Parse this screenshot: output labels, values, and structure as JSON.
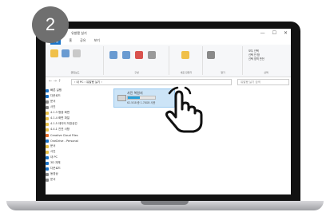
{
  "step": {
    "number": "2"
  },
  "window": {
    "title": "유발됐 실기",
    "minimize": "—",
    "maximize": "☐",
    "close": "✕"
  },
  "menu": [
    "파일",
    "홈",
    "공유",
    "보기"
  ],
  "ribbon": {
    "groups": [
      {
        "label": "클립보드",
        "buttons": [
          "즐겨찾기에 고정",
          "복사",
          "붙여넣기"
        ]
      },
      {
        "label": "구성",
        "buttons": [
          "이동",
          "복사",
          "삭제",
          "이름 바꾸기"
        ]
      },
      {
        "label": "새로 만들기",
        "buttons": [
          "새 폴더"
        ]
      },
      {
        "label": "열기",
        "buttons": [
          "속성"
        ]
      },
      {
        "label": "선택",
        "buttons": [
          "모두 선택",
          "선택 안 함",
          "선택 영역 반전"
        ]
      }
    ]
  },
  "address": {
    "path": "› 내 PC › 유발됐 실기 ›",
    "search": "유발됐 실기 검색"
  },
  "sidebar": {
    "items": [
      {
        "label": "빠른 실행",
        "color": "#1a73c8"
      },
      {
        "label": "다운로드",
        "color": "#1a73c8"
      },
      {
        "label": "문서",
        "color": "#8a8a8a"
      },
      {
        "label": "사진",
        "color": "#8a8a8a"
      },
      {
        "label": "4.1.3 형광 화면",
        "color": "#e8c14a"
      },
      {
        "label": "4.1.4 화면 파일",
        "color": "#e8c14a"
      },
      {
        "label": "4.1.5 데이터 저장공간",
        "color": "#e8c14a"
      },
      {
        "label": "4.4.1 진연 사항",
        "color": "#e8c14a"
      },
      {
        "label": "Creative Cloud Files",
        "color": "#e46b2b"
      },
      {
        "label": "OneDrive - Personal",
        "color": "#1a73c8"
      },
      {
        "label": "문서",
        "color": "#e8c14a"
      },
      {
        "label": "사진",
        "color": "#e8c14a"
      },
      {
        "label": "내 PC",
        "color": "#1a73c8"
      },
      {
        "label": "3D 개체",
        "color": "#1a73c8"
      },
      {
        "label": "다운로드",
        "color": "#1a73c8"
      },
      {
        "label": "동영상",
        "color": "#8a8a8a"
      },
      {
        "label": "문서",
        "color": "#8a8a8a"
      }
    ]
  },
  "drive": {
    "name": "사진 복원지",
    "size": "62.5GB 중 1.78GB 사용",
    "used_fraction": 0.45
  }
}
